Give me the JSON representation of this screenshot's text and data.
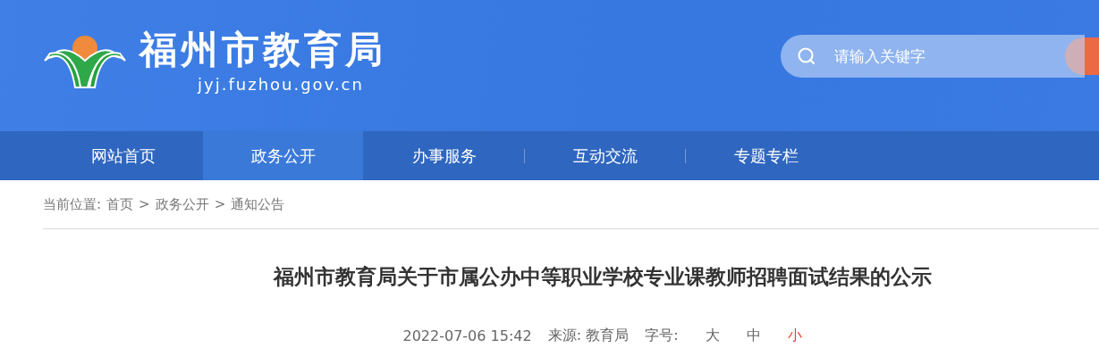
{
  "header": {
    "site_name": "福州市教育局",
    "site_url": "jyj.fuzhou.gov.cn",
    "search": {
      "placeholder": "请输入关键字"
    }
  },
  "nav": [
    {
      "label": "网站首页",
      "selected": false
    },
    {
      "label": "政务公开",
      "selected": true
    },
    {
      "label": "办事服务",
      "selected": false
    },
    {
      "label": "互动交流",
      "selected": false
    },
    {
      "label": "专题专栏",
      "selected": false
    }
  ],
  "breadcrumb": {
    "label": "当前位置:",
    "items": [
      "首页",
      "政务公开",
      "通知公告"
    ],
    "separator": ">"
  },
  "article": {
    "title": "福州市教育局关于市属公办中等职业学校专业课教师招聘面试结果的公示",
    "date": "2022-07-06 15:42",
    "source": "来源: 教育局",
    "font_size_label": "字号:",
    "font_sizes": [
      {
        "label": "大",
        "selected": false
      },
      {
        "label": "中",
        "selected": false
      },
      {
        "label": "小",
        "selected": true
      }
    ]
  }
}
